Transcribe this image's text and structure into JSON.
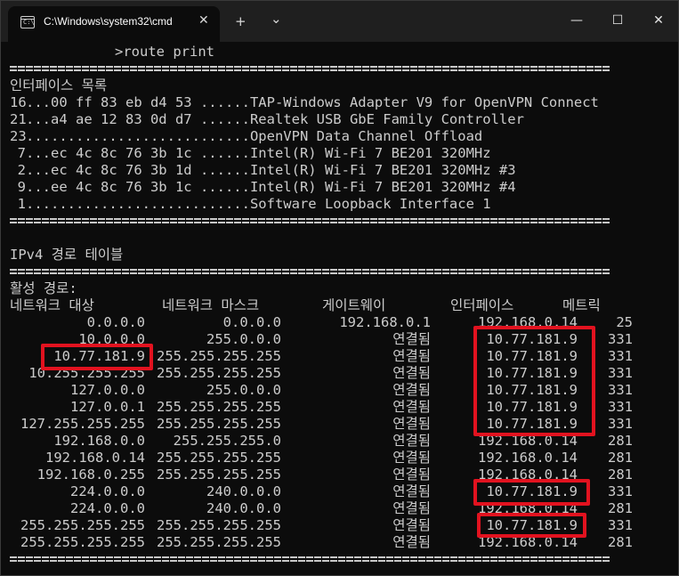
{
  "window": {
    "tab_icon_text": "C:\\",
    "tab_title": "C:\\Windows\\system32\\cmd",
    "tab_close": "✕",
    "new_tab": "+",
    "dropdown": "⌄",
    "minimize": "—",
    "maximize": "☐",
    "close": "✕"
  },
  "prompt": {
    "command": ">route print"
  },
  "interface_list": {
    "title": "인터페이스 목록",
    "rows": [
      {
        "idx": "16",
        "text": "...00 ff 83 eb d4 53 ......TAP-Windows Adapter V9 for OpenVPN Connect"
      },
      {
        "idx": "21",
        "text": "...a4 ae 12 83 0d d7 ......Realtek USB GbE Family Controller"
      },
      {
        "idx": "23",
        "text": "...........................OpenVPN Data Channel Offload"
      },
      {
        "idx": "7",
        "text": "...ec 4c 8c 76 3b 1c ......Intel(R) Wi-Fi 7 BE201 320MHz"
      },
      {
        "idx": "2",
        "text": "...ec 4c 8c 76 3b 1d ......Intel(R) Wi-Fi 7 BE201 320MHz #3"
      },
      {
        "idx": "9",
        "text": "...ee 4c 8c 76 3b 1c ......Intel(R) Wi-Fi 7 BE201 320MHz #4"
      },
      {
        "idx": "1",
        "text": "...........................Software Loopback Interface 1"
      }
    ]
  },
  "ipv4": {
    "title": "IPv4 경로 테이블",
    "active_label": "활성 경로:",
    "headers": {
      "destination": "네트워크 대상",
      "mask": "네트워크 마스크",
      "gateway": "게이트웨이",
      "interface": "인터페이스",
      "metric": "메트릭"
    },
    "routes": [
      {
        "dest": "0.0.0.0",
        "mask": "0.0.0.0",
        "gateway": "192.168.0.1",
        "iface": "192.168.0.14",
        "metric": "25"
      },
      {
        "dest": "10.0.0.0",
        "mask": "255.0.0.0",
        "gateway": "연결됨",
        "iface": "10.77.181.9",
        "metric": "331"
      },
      {
        "dest": "10.77.181.9",
        "mask": "255.255.255.255",
        "gateway": "연결됨",
        "iface": "10.77.181.9",
        "metric": "331"
      },
      {
        "dest": "10.255.255.255",
        "mask": "255.255.255.255",
        "gateway": "연결됨",
        "iface": "10.77.181.9",
        "metric": "331"
      },
      {
        "dest": "127.0.0.0",
        "mask": "255.0.0.0",
        "gateway": "연결됨",
        "iface": "10.77.181.9",
        "metric": "331"
      },
      {
        "dest": "127.0.0.1",
        "mask": "255.255.255.255",
        "gateway": "연결됨",
        "iface": "10.77.181.9",
        "metric": "331"
      },
      {
        "dest": "127.255.255.255",
        "mask": "255.255.255.255",
        "gateway": "연결됨",
        "iface": "10.77.181.9",
        "metric": "331"
      },
      {
        "dest": "192.168.0.0",
        "mask": "255.255.255.0",
        "gateway": "연결됨",
        "iface": "192.168.0.14",
        "metric": "281"
      },
      {
        "dest": "192.168.0.14",
        "mask": "255.255.255.255",
        "gateway": "연결됨",
        "iface": "192.168.0.14",
        "metric": "281"
      },
      {
        "dest": "192.168.0.255",
        "mask": "255.255.255.255",
        "gateway": "연결됨",
        "iface": "192.168.0.14",
        "metric": "281"
      },
      {
        "dest": "224.0.0.0",
        "mask": "240.0.0.0",
        "gateway": "연결됨",
        "iface": "10.77.181.9",
        "metric": "331"
      },
      {
        "dest": "224.0.0.0",
        "mask": "240.0.0.0",
        "gateway": "연결됨",
        "iface": "192.168.0.14",
        "metric": "281"
      },
      {
        "dest": "255.255.255.255",
        "mask": "255.255.255.255",
        "gateway": "연결됨",
        "iface": "10.77.181.9",
        "metric": "331"
      },
      {
        "dest": "255.255.255.255",
        "mask": "255.255.255.255",
        "gateway": "연결됨",
        "iface": "192.168.0.14",
        "metric": "281"
      }
    ]
  },
  "colors": {
    "background": "#0c0c0c",
    "text": "#cccccc",
    "highlight": "#e2121f",
    "titlebar": "#1f1f1f"
  }
}
